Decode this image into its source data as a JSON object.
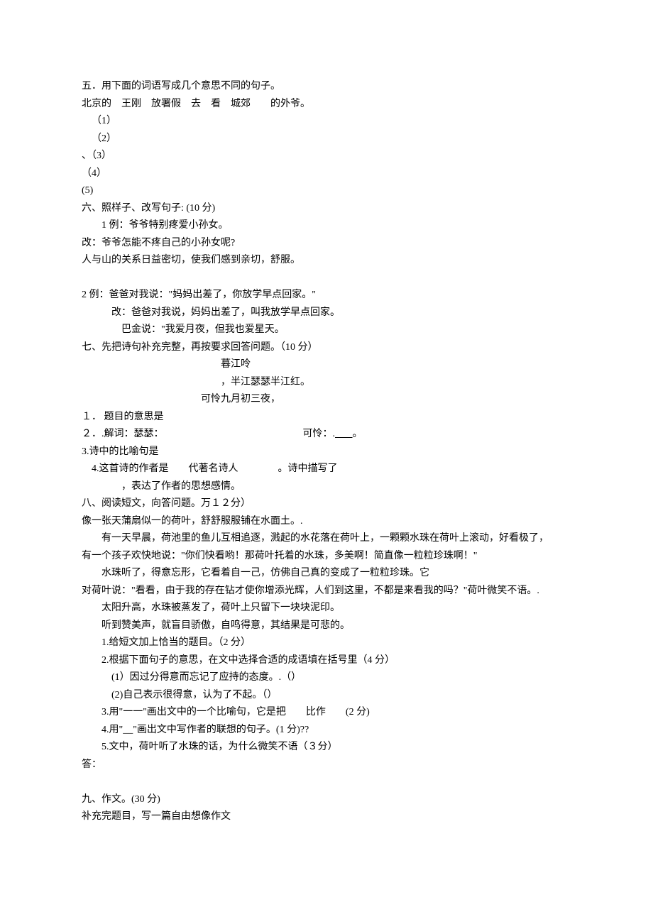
{
  "q5": {
    "title": "五．用下面的词语写成几个意思不同的句子。",
    "words": "北京的　王刚　放署假　去　看　城郊　　的外爷。",
    "items": [
      "（1）",
      "（2）",
      "、（3）",
      "（4）",
      "(5)"
    ]
  },
  "q6": {
    "title": "六、照样子、改写句子: (10 分)",
    "ex1a": "1 例：爷爷特别疼爱小孙女。",
    "ex1b": "改：爷爷怎能不疼自己的小孙女呢?",
    "ex1c": "人与山的关系日益密切，使我们感到亲切，舒服。",
    "ex2a": "2 例：爸爸对我说：\"妈妈出差了，你放学早点回家。\"",
    "ex2b": "改：爸爸对我说，妈妈出差了，叫我放学早点回家。",
    "ex2c": "巴金说：\"我爱月夜，但我也爱星天。"
  },
  "q7": {
    "title": "七、先把诗句补充完整，再按要求回答问题。（10 分）",
    "poem_title": "暮江呤",
    "poem_line1": "，半江瑟瑟半江红。",
    "poem_line2": "可怜九月初三夜，",
    "sub1": "１． 题目的意思是",
    "sub2a": "２．.解词：瑟瑟：",
    "sub2b": "可怜：.",
    "sub2c": "。",
    "sub3": "3.诗中的比喻句是",
    "sub4a": "4.这首诗的作者是　　代著名诗人　　　　。诗中描写了",
    "sub4b": "，表达了作者的思想感情。"
  },
  "q8": {
    "title": "八、阅读短文，向答问题。万１２分）",
    "p1": "像一张天蒲扇似一的荷叶，舒舒服服铺在水面土。.",
    "p2": "有一天早晨，荷池里的鱼儿互相追逐，溅起的水花落在荷叶上，一颗颗水珠在荷叶上滚动，好看极了，",
    "p3": "有一个孩子欢快地说：\"你们快看哟！那荷叶托着的水珠，多美啊！简直像一粒粒珍珠啊！\"",
    "p4": "水珠听了，得意忘形，它看着自一己，仿佛自己真的变成了一粒粒珍珠。它",
    "p5": "对荷叶说：\"看看，由于我的存在钻才使你增添光辉，人们到这里，不都是来看我的吗？\"荷叶微笑不语。.",
    "p6": "太阳升高，水珠被蒸发了，荷叶上只留下一块块泥印。",
    "p7": "听到赞美声，就盲目骄傲，自鸣得意，其结果是可悲的。",
    "sub1": "1.给短文加上恰当的题目。（2 分）",
    "sub2": "2.根据下面句子的意思，在文中选择合适的成语填在括号里（4 分）",
    "sub2a": "(1）因过分得意而忘记了应持的态度。.（）",
    "sub2b": "(2)自己表示很得意，认为了不起。（）",
    "sub3": "3.用\"一一\"画出文中的一个比喻句，它是把　　比作　　(2 分)",
    "sub4": "4.用\"__\"画出文中写作者的联想的句子。(1 分)??",
    "sub5": "5.文中，荷叶听了水珠的话，为什么微笑不语（３分）",
    "ans": "答："
  },
  "q9": {
    "title": "九、作文。(30 分)",
    "line": "补充完题目，写一篇自由想像作文"
  }
}
